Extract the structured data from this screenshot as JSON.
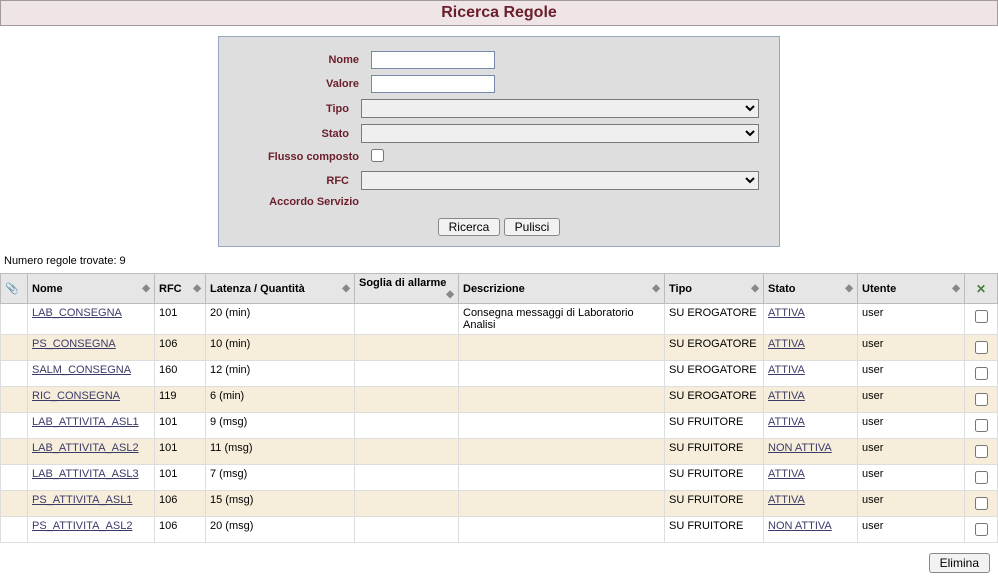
{
  "title": "Ricerca Regole",
  "form": {
    "nome_label": "Nome",
    "valore_label": "Valore",
    "tipo_label": "Tipo",
    "stato_label": "Stato",
    "flusso_label": "Flusso composto",
    "rfc_label": "RFC",
    "accordo_label": "Accordo Servizio",
    "nome_value": "",
    "valore_value": "",
    "tipo_value": "",
    "stato_value": "",
    "rfc_value": "",
    "flusso_checked": false,
    "ricerca_button": "Ricerca",
    "pulisci_button": "Pulisci"
  },
  "result_count_text": "Numero regole trovate: 9",
  "columns": {
    "nome": "Nome",
    "rfc": "RFC",
    "latenza": "Latenza / Quantità",
    "soglia": "Soglia di allarme",
    "descrizione": "Descrizione",
    "tipo": "Tipo",
    "stato": "Stato",
    "utente": "Utente"
  },
  "rows": [
    {
      "nome": "LAB_CONSEGNA",
      "rfc": "101",
      "latenza": "20 (min)",
      "soglia": "",
      "descrizione": "Consegna messaggi di Laboratorio Analisi",
      "tipo": "SU EROGATORE",
      "stato": "ATTIVA",
      "utente": "user"
    },
    {
      "nome": "PS_CONSEGNA",
      "rfc": "106",
      "latenza": "10 (min)",
      "soglia": "",
      "descrizione": "",
      "tipo": "SU EROGATORE",
      "stato": "ATTIVA",
      "utente": "user"
    },
    {
      "nome": "SALM_CONSEGNA",
      "rfc": "160",
      "latenza": "12 (min)",
      "soglia": "",
      "descrizione": "",
      "tipo": "SU EROGATORE",
      "stato": "ATTIVA",
      "utente": "user"
    },
    {
      "nome": "RIC_CONSEGNA",
      "rfc": "119",
      "latenza": "6 (min)",
      "soglia": "",
      "descrizione": "",
      "tipo": "SU EROGATORE",
      "stato": "ATTIVA",
      "utente": "user"
    },
    {
      "nome": "LAB_ATTIVITA_ASL1",
      "rfc": "101",
      "latenza": "9 (msg)",
      "soglia": "",
      "descrizione": "",
      "tipo": "SU FRUITORE",
      "stato": "ATTIVA",
      "utente": "user"
    },
    {
      "nome": "LAB_ATTIVITA_ASL2",
      "rfc": "101",
      "latenza": "11 (msg)",
      "soglia": "",
      "descrizione": "",
      "tipo": "SU FRUITORE",
      "stato": "NON ATTIVA",
      "utente": "user"
    },
    {
      "nome": "LAB_ATTIVITA_ASL3",
      "rfc": "101",
      "latenza": "7 (msg)",
      "soglia": "",
      "descrizione": "",
      "tipo": "SU FRUITORE",
      "stato": "ATTIVA",
      "utente": "user"
    },
    {
      "nome": "PS_ATTIVITA_ASL1",
      "rfc": "106",
      "latenza": "15 (msg)",
      "soglia": "",
      "descrizione": "",
      "tipo": "SU FRUITORE",
      "stato": "ATTIVA",
      "utente": "user"
    },
    {
      "nome": "PS_ATTIVITA_ASL2",
      "rfc": "106",
      "latenza": "20 (msg)",
      "soglia": "",
      "descrizione": "",
      "tipo": "SU FRUITORE",
      "stato": "NON ATTIVA",
      "utente": "user"
    }
  ],
  "elimina_button": "Elimina"
}
